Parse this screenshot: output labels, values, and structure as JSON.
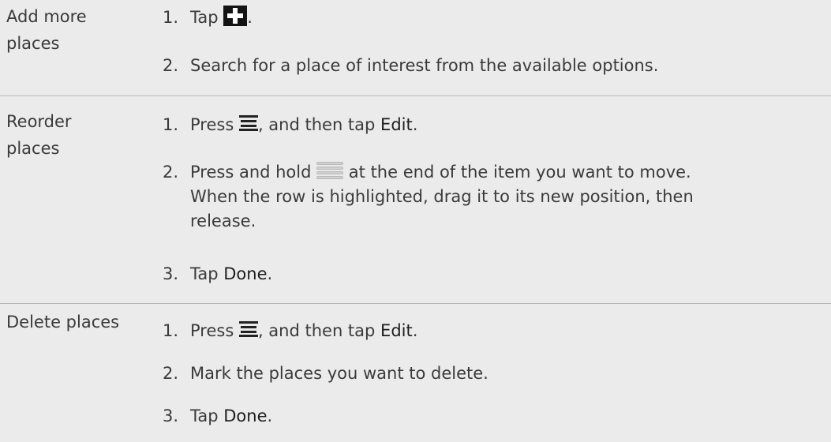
{
  "rows": [
    {
      "label": [
        "Add more",
        "places"
      ],
      "steps": [
        {
          "num": "1.",
          "pre": "Tap ",
          "icon": "plus-icon",
          "post": "."
        },
        {
          "num": "2.",
          "text": "Search for a place of interest from the available options."
        }
      ]
    },
    {
      "label": [
        "Reorder",
        "places"
      ],
      "steps": [
        {
          "num": "1.",
          "pre": "Press ",
          "icon": "menu-icon",
          "post": ", and then tap ",
          "ui": "Edit",
          "end": "."
        },
        {
          "num": "2.",
          "pre": "Press and hold ",
          "icon": "drag-handle-icon",
          "lines": [
            " at the end of the item you want to move.",
            "When the row is highlighted, drag it to its new position, then",
            "release."
          ]
        },
        {
          "num": "3.",
          "pre": "Tap ",
          "ui": "Done",
          "end": "."
        }
      ]
    },
    {
      "label": [
        "Delete places"
      ],
      "steps": [
        {
          "num": "1.",
          "pre": "Press ",
          "icon": "menu-icon",
          "post": ", and then tap ",
          "ui": "Edit",
          "end": "."
        },
        {
          "num": "2.",
          "text": "Mark the places you want to delete."
        },
        {
          "num": "3.",
          "pre": "Tap ",
          "ui": "Done",
          "end": "."
        }
      ]
    }
  ]
}
